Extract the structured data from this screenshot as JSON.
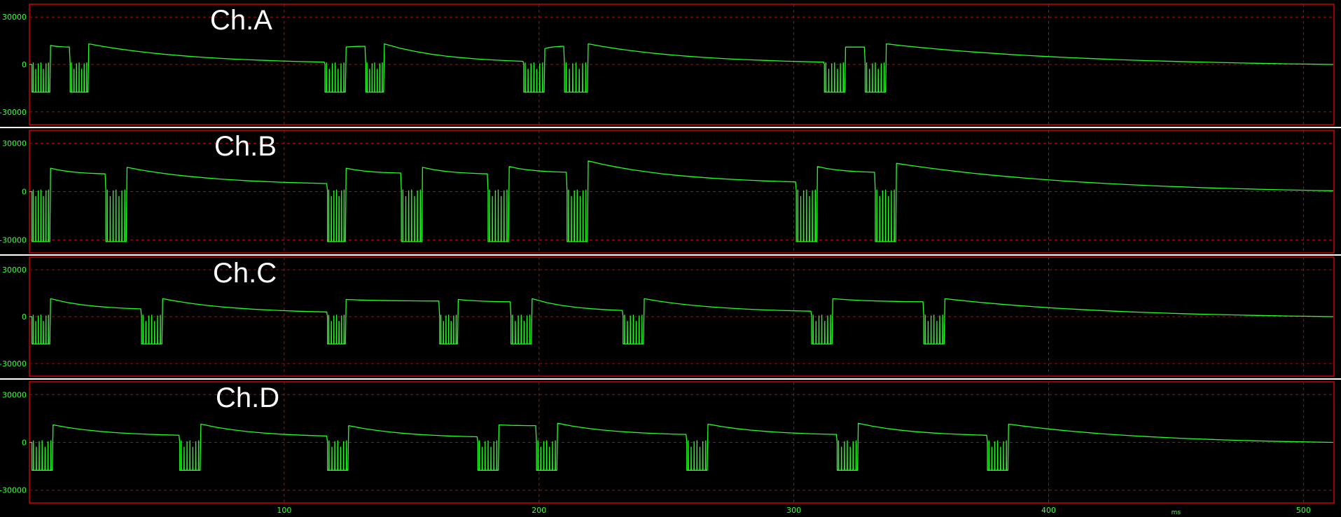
{
  "colors": {
    "trace": "#22ff22",
    "grid": "#a01010",
    "frame": "#cc0000",
    "separator": "#ffffff",
    "background": "#000000",
    "labels": "#3cff3c"
  },
  "chart_data": {
    "type": "line",
    "xlim": [
      0,
      512
    ],
    "x_ticks": [
      100,
      200,
      300,
      400,
      500
    ],
    "x_tick_labels": [
      "100",
      "200",
      "300",
      "400",
      "500"
    ],
    "x_unit": "ms",
    "ylim": [
      -32767,
      32767
    ],
    "y_ticks": [
      30000,
      0,
      -30000
    ],
    "y_tick_labels": [
      "30000",
      "0",
      "-30000"
    ],
    "grid": true,
    "series": [
      {
        "name": "Ch.A",
        "burst_low": -17500,
        "bursts": [
          {
            "start": 1,
            "end": 8,
            "jump": 12000,
            "next_from": 11000
          },
          {
            "start": 16,
            "end": 23,
            "jump": 13000,
            "next_from": 1500
          },
          {
            "start": 116,
            "end": 124,
            "jump": 11000,
            "next_from": 11500
          },
          {
            "start": 132,
            "end": 139,
            "jump": 13000,
            "next_from": 2000
          },
          {
            "start": 194,
            "end": 202,
            "jump": 10000,
            "next_from": 11500
          },
          {
            "start": 210,
            "end": 219,
            "jump": 13000,
            "next_from": 1500
          },
          {
            "start": 312,
            "end": 320,
            "jump": 11000,
            "next_from": 11000
          },
          {
            "start": 328,
            "end": 336,
            "jump": 13000,
            "next_from": 0
          }
        ]
      },
      {
        "name": "Ch.B",
        "burst_low": -31000,
        "bursts": [
          {
            "start": 1,
            "end": 8,
            "jump": 14500,
            "next_from": 11000
          },
          {
            "start": 30,
            "end": 38,
            "jump": 15000,
            "next_from": 5000
          },
          {
            "start": 117,
            "end": 124,
            "jump": 14500,
            "next_from": 11500
          },
          {
            "start": 146,
            "end": 154,
            "jump": 15000,
            "next_from": 11000
          },
          {
            "start": 180,
            "end": 188,
            "jump": 15500,
            "next_from": 12000
          },
          {
            "start": 211,
            "end": 219,
            "jump": 19000,
            "next_from": 6000
          },
          {
            "start": 301,
            "end": 309,
            "jump": 15500,
            "next_from": 12000
          },
          {
            "start": 332,
            "end": 340,
            "jump": 17500,
            "next_from": 500
          }
        ]
      },
      {
        "name": "Ch.C",
        "burst_low": -17500,
        "bursts": [
          {
            "start": 1,
            "end": 8,
            "jump": 11500,
            "next_from": 5000
          },
          {
            "start": 44,
            "end": 52,
            "jump": 11500,
            "next_from": 3000
          },
          {
            "start": 117,
            "end": 124,
            "jump": 11000,
            "next_from": 10000
          },
          {
            "start": 161,
            "end": 168,
            "jump": 11000,
            "next_from": 9500
          },
          {
            "start": 189,
            "end": 197,
            "jump": 11500,
            "next_from": 4000
          },
          {
            "start": 233,
            "end": 241,
            "jump": 11500,
            "next_from": 3500
          },
          {
            "start": 307,
            "end": 315,
            "jump": 11500,
            "next_from": 9500
          },
          {
            "start": 351,
            "end": 359,
            "jump": 11500,
            "next_from": 0
          }
        ]
      },
      {
        "name": "Ch.D",
        "burst_low": -17500,
        "bursts": [
          {
            "start": 1,
            "end": 9,
            "jump": 11000,
            "next_from": 4500
          },
          {
            "start": 59,
            "end": 67,
            "jump": 11500,
            "next_from": 4000
          },
          {
            "start": 117,
            "end": 125,
            "jump": 10500,
            "next_from": 3500
          },
          {
            "start": 176,
            "end": 184,
            "jump": 11000,
            "next_from": 10500
          },
          {
            "start": 199,
            "end": 207,
            "jump": 12000,
            "next_from": 5000
          },
          {
            "start": 258,
            "end": 266,
            "jump": 11500,
            "next_from": 5000
          },
          {
            "start": 317,
            "end": 325,
            "jump": 12000,
            "next_from": 4500
          },
          {
            "start": 376,
            "end": 384,
            "jump": 11500,
            "next_from": 0
          }
        ]
      }
    ]
  }
}
